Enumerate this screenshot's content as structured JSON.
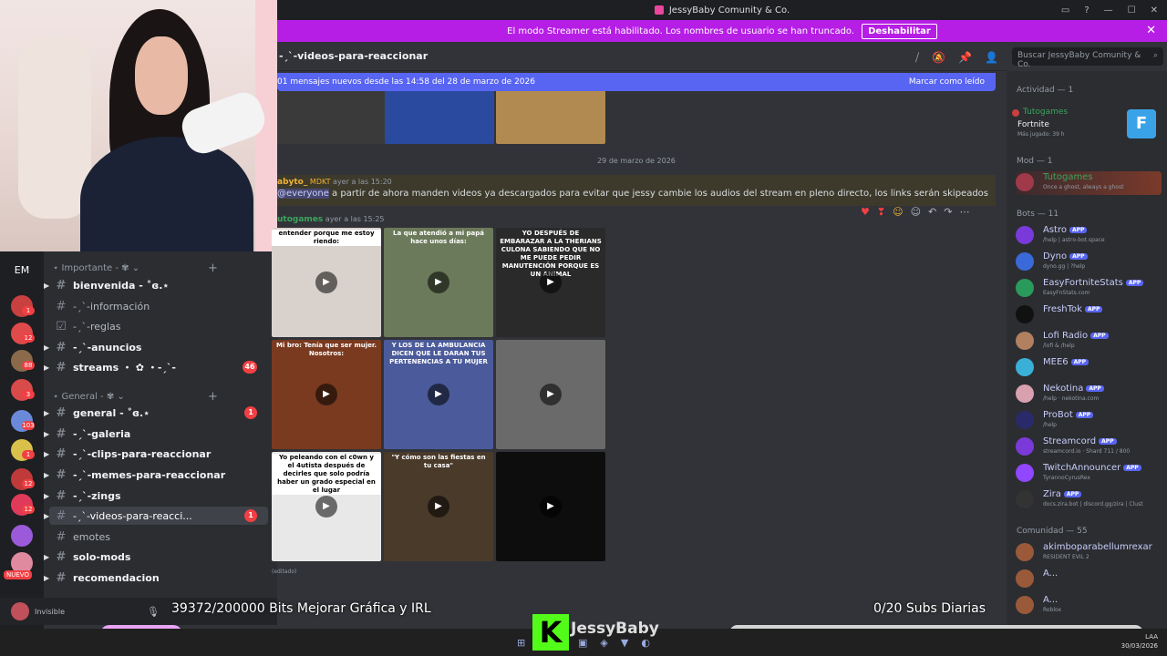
{
  "window": {
    "title": "JessyBaby Comunity & Co."
  },
  "banner": {
    "text": "El modo Streamer está habilitado. Los nombres de usuario se han truncado.",
    "button": "Deshabilitar"
  },
  "header": {
    "channel": "-ˏˋ-videos-para-reaccionar",
    "search_placeholder": "Buscar JessyBaby Comunity & Co."
  },
  "newbar": {
    "text": "01 mensajes nuevos desde las 14:58 del 28 de marzo de 2026",
    "action": "Marcar como leído"
  },
  "rail": {
    "label": "EM",
    "nuevo": "NUEVO",
    "badges": [
      "1",
      "12",
      "88",
      "3",
      "103",
      "1",
      "12",
      "12"
    ]
  },
  "categories": [
    {
      "label": "⋆ Importante - ✾ ⌄"
    },
    {
      "label": "⋆ General - ✾ ⌄"
    }
  ],
  "channels": [
    {
      "label": "bienvenida - ˚ɞ.⋆",
      "badge": ""
    },
    {
      "label": "-ˏˋ-información",
      "badge": ""
    },
    {
      "label": "-ˏˋ-reglas",
      "badge": ""
    },
    {
      "label": "-ˏˋ-anuncios",
      "badge": ""
    },
    {
      "label": "streams ・ ✿ ・-ˏˋ-",
      "badge": "46"
    },
    {
      "label": "general - ˚ɞ.⋆",
      "badge": "1"
    },
    {
      "label": "-ˏˋ-galeria",
      "badge": ""
    },
    {
      "label": "-ˏˋ-clips-para-reaccionar",
      "badge": ""
    },
    {
      "label": "-ˏˋ-memes-para-reaccionar",
      "badge": ""
    },
    {
      "label": "-ˏˋ-zings",
      "badge": ""
    },
    {
      "label": "-ˏˋ-videos-para-reacci...",
      "badge": "1"
    },
    {
      "label": "emotes",
      "badge": ""
    },
    {
      "label": "solo-mods",
      "badge": ""
    },
    {
      "label": "recomendacion",
      "badge": ""
    }
  ],
  "user": {
    "status": "Invisible"
  },
  "date_divider": "29 de marzo de 2026",
  "message1": {
    "author": "abyto_",
    "tag": "MDKT",
    "time": "ayer a las 15:20",
    "mention": "@everyone",
    "text": " a partir de ahora manden videos ya descargados para evitar que jessy cambie los audios del stream en pleno directo, los links serán skipeados"
  },
  "message2": {
    "author": "utogames",
    "time": "ayer a las 15:25",
    "edited": "(editado)"
  },
  "videos": [
    {
      "caption": "entender porque me estoy riendo:",
      "color": "#d9d2cc"
    },
    {
      "caption": "La que atendió a mi papá hace unos días:",
      "color": "#6b7a5a"
    },
    {
      "caption": "YO DESPUÉS DE EMBARAZAR A LA THERIANS CULONA SABIENDO QUE NO ME PUEDE PEDIR MANUTENCIÓN PORQUE ES UN ANIMAL",
      "color": "#2a2a2a"
    },
    {
      "caption": "Mi bro: Tenía que ser mujer. Nosotros:",
      "color": "#7a3a20"
    },
    {
      "caption": "Y LOS DE LA AMBULANCIA DICEN QUE LE DARAN TUS PERTENENCIAS A TU MUJER",
      "color": "#4a5a9a"
    },
    {
      "caption": "",
      "color": "#6a6a6a"
    },
    {
      "caption": "Yo peleando con el c0wn y el 4utista después de decirles que solo podría haber un grado especial en el lugar",
      "color": "#e8e8e8"
    },
    {
      "caption": "\"Y cómo son las fiestas en tu casa\"",
      "color": "#4a3a2a"
    },
    {
      "caption": "",
      "color": "#0d0d0d"
    }
  ],
  "members": {
    "activity_title": "Actividad — 1",
    "activity_user": "Tutogames",
    "activity_game": "Fortnite",
    "activity_sub": "Más jugado: 39 h",
    "mod_title": "Mod — 1",
    "mod": {
      "name": "Tutogames",
      "sub": "Once a ghost, always a ghost"
    },
    "bots_title": "Bots — 11",
    "bots": [
      {
        "name": "Astro",
        "sub": "/help | astro-bot.space",
        "color": "#7a3ad9"
      },
      {
        "name": "Dyno",
        "sub": "dyno.gg | ?help",
        "color": "#3a6ad9"
      },
      {
        "name": "EasyFortniteStats",
        "sub": "EasyFnStats.com",
        "color": "#2a9a5a"
      },
      {
        "name": "FreshTok",
        "sub": "",
        "color": "#111111"
      },
      {
        "name": "Lofi Radio",
        "sub": "/lofi & /help",
        "color": "#b08060"
      },
      {
        "name": "MEE6",
        "sub": "",
        "color": "#3ab0d9"
      },
      {
        "name": "Nekotina",
        "sub": "/help · nekotina.com",
        "color": "#d9a0b0"
      },
      {
        "name": "ProBot",
        "sub": "/help",
        "color": "#2a2a6a"
      },
      {
        "name": "Streamcord",
        "sub": "streamcord.io · Shard 711 / 800",
        "color": "#7a3ad9"
      },
      {
        "name": "TwitchAnnouncer",
        "sub": "TyrannoCyrusRex",
        "color": "#9146ff"
      },
      {
        "name": "Zira",
        "sub": "docs.zira.bot | discord.gg/zira | Clust",
        "color": "#333333"
      }
    ],
    "app_label": "APP",
    "community_title": "Comunidad — 55",
    "community": [
      {
        "name": "akimboparabellumrexar",
        "sub": "RESIDENT EVIL 2"
      },
      {
        "name": "A...",
        "sub": ""
      },
      {
        "name": "A...",
        "sub": "Roblox"
      }
    ]
  },
  "overlay": {
    "bits": "39372/200000 Bits Mejorar Gráfica y IRL",
    "subs": "0/20 Subs Diarias",
    "brand": "JessyBaby",
    "kick": "K"
  },
  "tray": {
    "lang": "LAA",
    "date": "30/03/2026"
  }
}
